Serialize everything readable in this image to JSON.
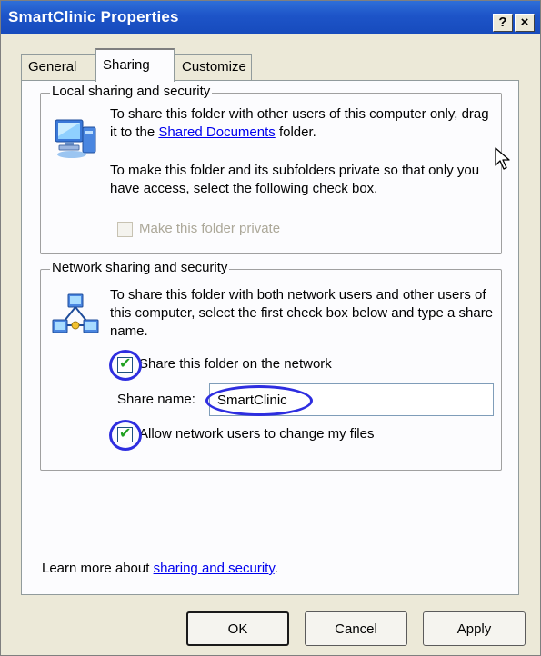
{
  "window": {
    "title": "SmartClinic Properties",
    "help_glyph": "?",
    "close_glyph": "×"
  },
  "tabs": [
    {
      "label": "General"
    },
    {
      "label": "Sharing",
      "selected": true
    },
    {
      "label": "Customize"
    }
  ],
  "local_group": {
    "title": "Local sharing and security",
    "para1_before": "To share this folder with other users of this computer only, drag it to the ",
    "para1_link": "Shared Documents",
    "para1_after": " folder.",
    "para2": "To make this folder and its subfolders private so that only you have access, select the following check box.",
    "private_checkbox": {
      "label": "Make this folder private",
      "checked": false,
      "disabled": true
    }
  },
  "network_group": {
    "title": "Network sharing and security",
    "para": "To share this folder with both network users and other users of this computer, select the first check box below and type a share name.",
    "share_checkbox": {
      "label": "Share this folder on the network",
      "checked": true
    },
    "share_name_label": "Share name:",
    "share_name_value": "SmartClinic",
    "allow_checkbox": {
      "label": "Allow network users to change my files",
      "checked": true
    }
  },
  "learn_more": {
    "prefix": "Learn more about ",
    "link": "sharing and security",
    "suffix": "."
  },
  "buttons": {
    "ok": "OK",
    "cancel": "Cancel",
    "apply": "Apply"
  },
  "colors": {
    "titlebar": "#1d54c8",
    "annotation_circle": "#2e2ee0",
    "link": "#0000ee"
  },
  "icons": [
    "computer-icon",
    "network-icon",
    "mouse-cursor-icon"
  ]
}
